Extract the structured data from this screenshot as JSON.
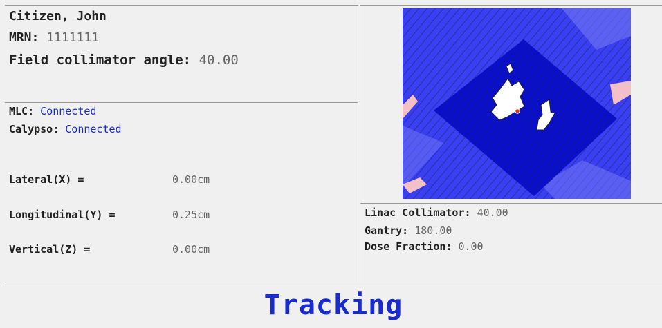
{
  "patient": {
    "name": "Citizen, John",
    "mrn_label": "MRN:",
    "mrn_value": "1111111",
    "angle_label": "Field collimator angle:",
    "angle_value": "40.00"
  },
  "status": {
    "mlc_label": "MLC:",
    "mlc_value": "Connected",
    "calypso_label": "Calypso:",
    "calypso_value": "Connected",
    "colors": {
      "connected": "#1a2bd0"
    }
  },
  "motion": [
    {
      "label": "Lateral(X) =",
      "value": "0.00cm"
    },
    {
      "label": "Longitudinal(Y) =",
      "value": "0.25cm"
    },
    {
      "label": "Vertical(Z) =",
      "value": "0.00cm"
    }
  ],
  "linac": {
    "collimator_label": "Linac Collimator:",
    "collimator_value": "40.00",
    "gantry_label": "Gantry:",
    "gantry_value": "180.00",
    "dose_label": "Dose Fraction:",
    "dose_value": "0.00"
  },
  "tracking_status": "Tracking",
  "image_colors": {
    "background": "#3a3ff0",
    "field": "#0a0fc8",
    "leaf_lines": "#1a1a6a",
    "highlight": "#f4c0c8",
    "target": "#ffffff",
    "marker": "#e63c1e"
  }
}
